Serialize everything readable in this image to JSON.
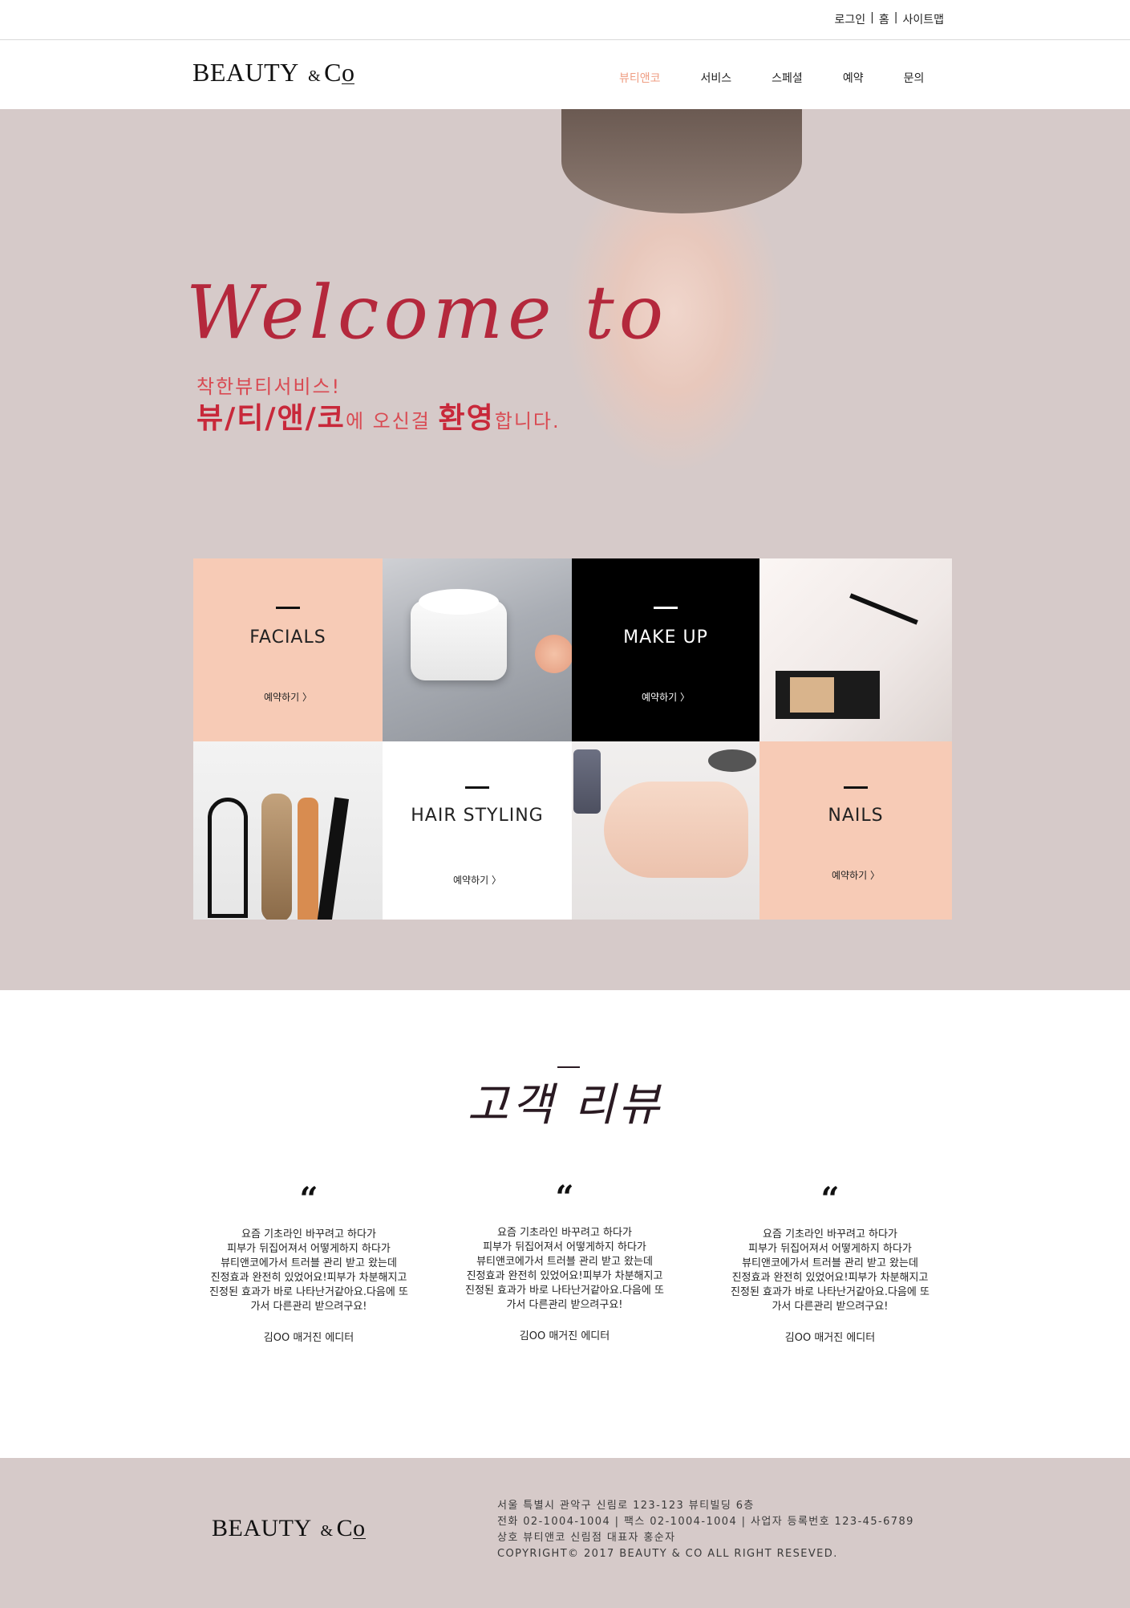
{
  "topbar": {
    "login": "로그인",
    "home": "홈",
    "sitemap": "사이트맵",
    "separator": "|"
  },
  "brand": {
    "name": "BEAUTY",
    "amp": "&",
    "suffix_c": "C",
    "suffix_o": "o"
  },
  "nav": {
    "items": [
      "뷰티앤코",
      "서비스",
      "스페셜",
      "예약",
      "문의"
    ],
    "active_index": 0
  },
  "hero": {
    "welcome": "Welcome to",
    "tagline1": "착한뷰티서비스!",
    "tagline2_brand": "뷰/티/앤/코",
    "tagline2_mid": "에 오신걸 ",
    "tagline2_emph": "환영",
    "tagline2_end": "합니다."
  },
  "services": [
    {
      "title": "FACIALS",
      "link": "예약하기 〉"
    },
    {
      "title": "MAKE UP",
      "link": "예약하기 〉"
    },
    {
      "title": "HAIR STYLING",
      "link": "예약하기 〉"
    },
    {
      "title": "NAILS",
      "link": "예약하기 〉"
    }
  ],
  "reviews": {
    "title": "고객 리뷰",
    "quote_mark": "“",
    "items": [
      {
        "text": "요즘 기초라인 바꾸려고 하다가\n피부가 뒤집어져서 어떻게하지 하다가\n뷰티앤코에가서 트러블 관리 받고 왔는데\n진정효과 완전히 있었어요!피부가 차분해지고\n진정된 효과가 바로 나타난거같아요.다음에 또\n가서 다른관리 받으려구요!",
        "author": "김OO 매거진 에디터"
      },
      {
        "text": "요즘 기초라인 바꾸려고 하다가\n피부가 뒤집어져서 어떻게하지 하다가\n뷰티앤코에가서 트러블 관리 받고 왔는데\n진정효과 완전히 있었어요!피부가 차분해지고\n진정된 효과가 바로 나타난거같아요.다음에 또\n가서 다른관리 받으려구요!",
        "author": "김OO 매거진 에디터"
      },
      {
        "text": "요즘 기초라인 바꾸려고 하다가\n피부가 뒤집어져서 어떻게하지 하다가\n뷰티앤코에가서 트러블 관리 받고 왔는데\n진정효과 완전히 있었어요!피부가 차분해지고\n진정된 효과가 바로 나타난거같아요.다음에 또\n가서 다른관리 받으려구요!",
        "author": "김OO 매거진 에디터"
      }
    ]
  },
  "footer": {
    "address": "서울 특별시 관악구 신림로 123-123 뷰티빌딩 6층",
    "contact": "전화 02-1004-1004 | 팩스 02-1004-1004 | 사업자 등록번호 123-45-6789",
    "company": "상호 뷰티앤코 신림점  대표자 홍순자",
    "copyright": "COPYRIGHT© 2017 BEAUTY & CO ALL RIGHT RESEVED."
  },
  "colors": {
    "accent": "#ef9e83",
    "hero_bg": "#d6cac9",
    "peach": "#f7cbb6",
    "hero_text": "#d94a52"
  }
}
